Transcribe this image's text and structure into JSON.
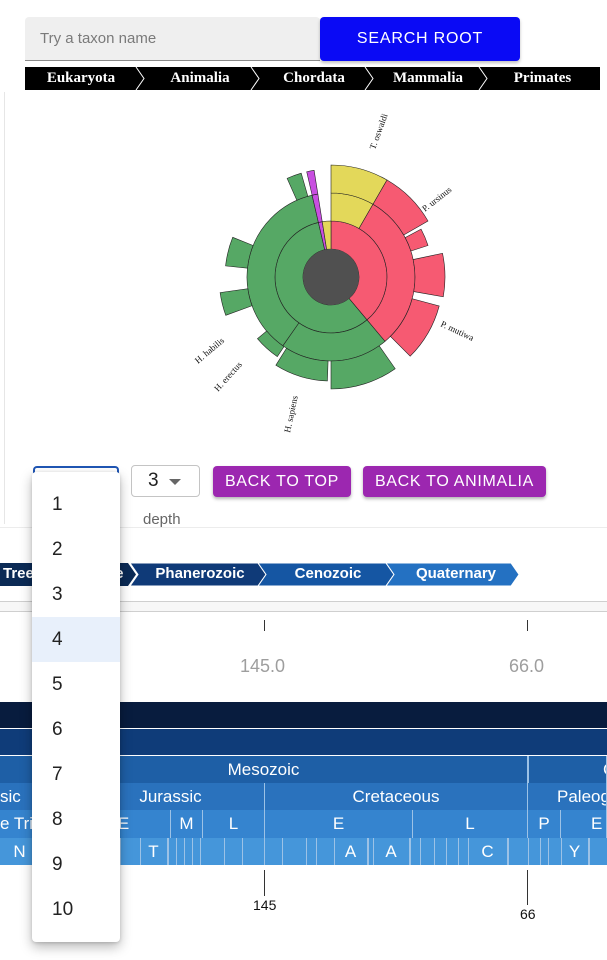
{
  "search": {
    "placeholder": "Try a taxon name",
    "button_label": "SEARCH ROOT"
  },
  "taxonomy_breadcrumb": [
    "Eukaryota",
    "Animalia",
    "Chordata",
    "Mammalia",
    "Primates"
  ],
  "sunburst": {
    "labels": [
      "T. oswaldi",
      "P. ursinus",
      "P. mutiwa",
      "H. sapiens",
      "H. erectus",
      "H. habilis"
    ],
    "colors": {
      "yellow": "#e3d85a",
      "pink": "#f65a72",
      "green": "#56a865",
      "purple": "#c84fe0",
      "center": "#505050"
    }
  },
  "controls": {
    "depth_value": "3",
    "depth_label": "depth",
    "back_to_top": "BACK TO TOP",
    "back_to_parent": "BACK TO ANIMALIA"
  },
  "depth_menu": {
    "options": [
      "1",
      "2",
      "3",
      "4",
      "5",
      "6",
      "7",
      "8",
      "9",
      "10"
    ],
    "selected": "4"
  },
  "geo_breadcrumb": [
    "Tree",
    "...e",
    "Phanerozoic",
    "Cenozoic",
    "Quaternary"
  ],
  "axis": {
    "tick_labels": [
      "145.0",
      "66.0"
    ],
    "bottom_labels": [
      "145",
      "66"
    ]
  },
  "timescale": {
    "era": [
      "Mesozoic",
      "C"
    ],
    "period": [
      "sic",
      "Jurassic",
      "Cretaceous",
      "Paleog"
    ],
    "epoch": [
      "e Tria",
      "E",
      "M",
      "L",
      "E",
      "L",
      "P",
      "E"
    ],
    "stage": [
      "N",
      "T",
      "A",
      "A",
      "C",
      "Y"
    ]
  }
}
